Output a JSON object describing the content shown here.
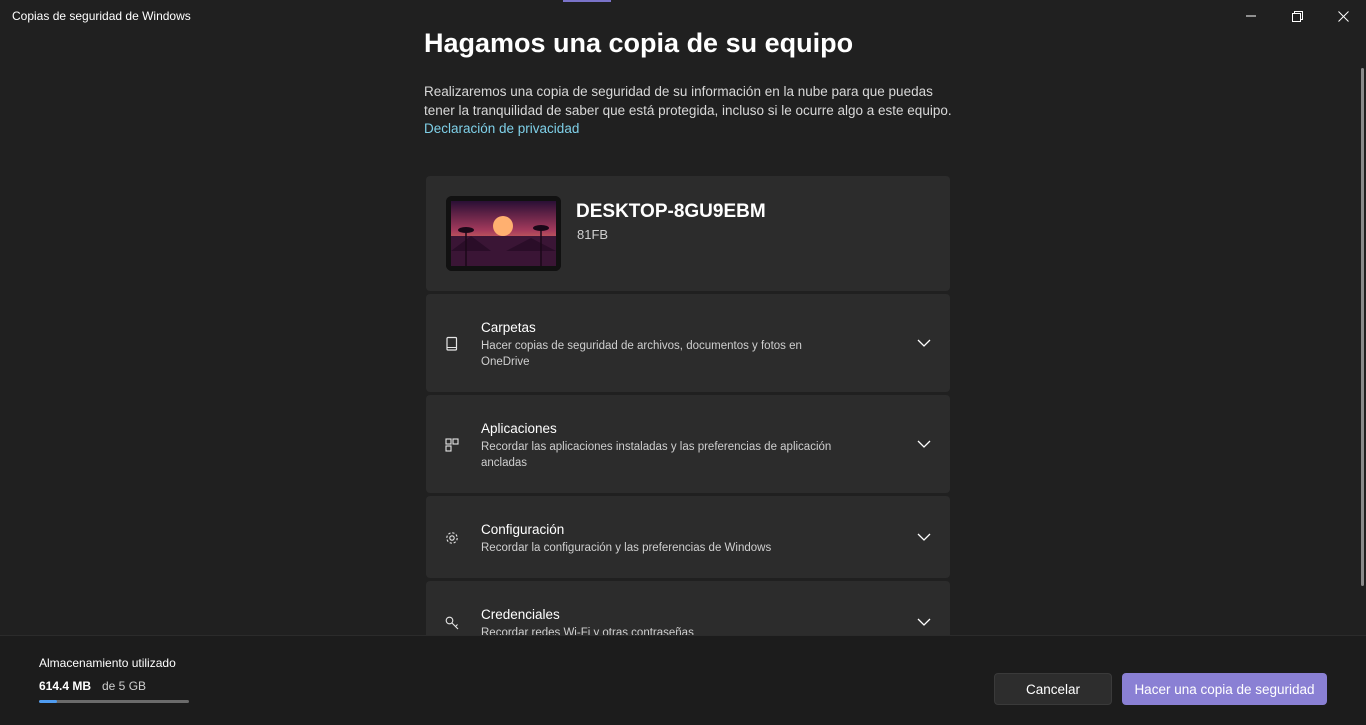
{
  "window": {
    "title": "Copias de seguridad de Windows",
    "controls": [
      "minimize-icon",
      "restore-icon",
      "close-icon"
    ]
  },
  "main": {
    "heading": "Hagamos una copia de su equipo",
    "description": "Realizaremos una copia de seguridad de su información en la nube para que puedas tener la tranquilidad de saber que está protegida, incluso si le ocurre algo a este equipo.",
    "privacy_link": "Declaración de privacidad"
  },
  "device": {
    "name": "DESKTOP-8GU9EBM",
    "model": "81FB"
  },
  "sections": [
    {
      "icon": "folder-icon",
      "title": "Carpetas",
      "subtitle": "Hacer copias de seguridad de archivos, documentos y fotos en OneDrive"
    },
    {
      "icon": "apps-icon",
      "title": "Aplicaciones",
      "subtitle": "Recordar las aplicaciones instaladas y las preferencias de aplicación ancladas"
    },
    {
      "icon": "gear-icon",
      "title": "Configuración",
      "subtitle": "Recordar la configuración y las preferencias de Windows"
    },
    {
      "icon": "key-icon",
      "title": "Credenciales",
      "subtitle": "Recordar redes Wi-Fi y otras contraseñas"
    }
  ],
  "storage": {
    "label": "Almacenamiento utilizado",
    "used": "614.4 MB",
    "total": "de 5 GB",
    "fraction": 0.12
  },
  "buttons": {
    "cancel": "Cancelar",
    "backup": "Hacer una copia de seguridad"
  },
  "colors": {
    "accent": "#8a80d4",
    "link": "#7fd0e8",
    "progress": "#4f9cf0"
  }
}
